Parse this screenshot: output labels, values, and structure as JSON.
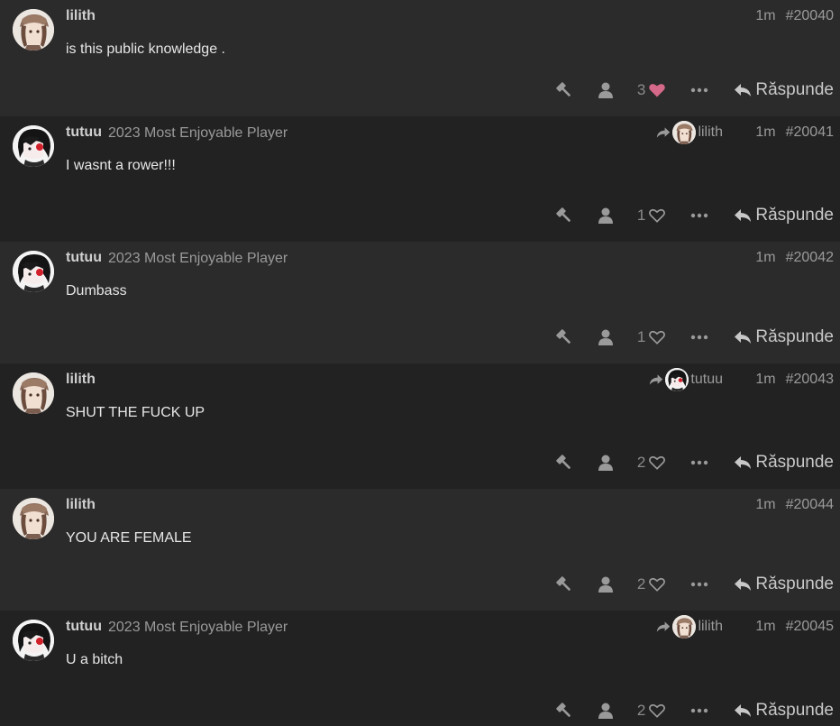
{
  "posts": [
    {
      "username": "lilith",
      "title": "",
      "age": "1m",
      "number": "#20040",
      "content": "is this public knowledge .",
      "reply_to": null,
      "likes": "3",
      "liked": true,
      "avatar": "lilith-avatar",
      "reply_label": "Răspunde"
    },
    {
      "username": "tutuu",
      "title": "2023 Most Enjoyable Player",
      "age": "1m",
      "number": "#20041",
      "content": "I wasnt a rower!!!",
      "reply_to": "lilith",
      "likes": "1",
      "liked": false,
      "avatar": "tutuu-avatar",
      "reply_label": "Răspunde"
    },
    {
      "username": "tutuu",
      "title": "2023 Most Enjoyable Player",
      "age": "1m",
      "number": "#20042",
      "content": "Dumbass",
      "reply_to": null,
      "likes": "1",
      "liked": false,
      "avatar": "tutuu-avatar",
      "reply_label": "Răspunde"
    },
    {
      "username": "lilith",
      "title": "",
      "age": "1m",
      "number": "#20043",
      "content": "SHUT THE FUCK UP",
      "reply_to": "tutuu",
      "likes": "2",
      "liked": false,
      "avatar": "lilith-avatar",
      "reply_label": "Răspunde"
    },
    {
      "username": "lilith",
      "title": "",
      "age": "1m",
      "number": "#20044",
      "content": "YOU ARE FEMALE",
      "reply_to": null,
      "likes": "2",
      "liked": false,
      "avatar": "lilith-avatar",
      "reply_label": "Răspunde"
    },
    {
      "username": "tutuu",
      "title": "2023 Most Enjoyable Player",
      "age": "1m",
      "number": "#20045",
      "content": "U a bitch",
      "reply_to": "lilith",
      "likes": "2",
      "liked": false,
      "avatar": "tutuu-avatar",
      "reply_label": "Răspunde"
    }
  ],
  "icons": {
    "flag": "hammer-icon",
    "user": "user-icon",
    "like": "heart-icon",
    "more": "ellipsis-icon",
    "reply": "reply-arrow-icon",
    "reply_to": "share-arrow-icon"
  },
  "colors": {
    "background_even": "#2b2b2b",
    "background_odd": "#222222",
    "liked_heart": "#d4698a",
    "muted_text": "#9a9a9a"
  }
}
